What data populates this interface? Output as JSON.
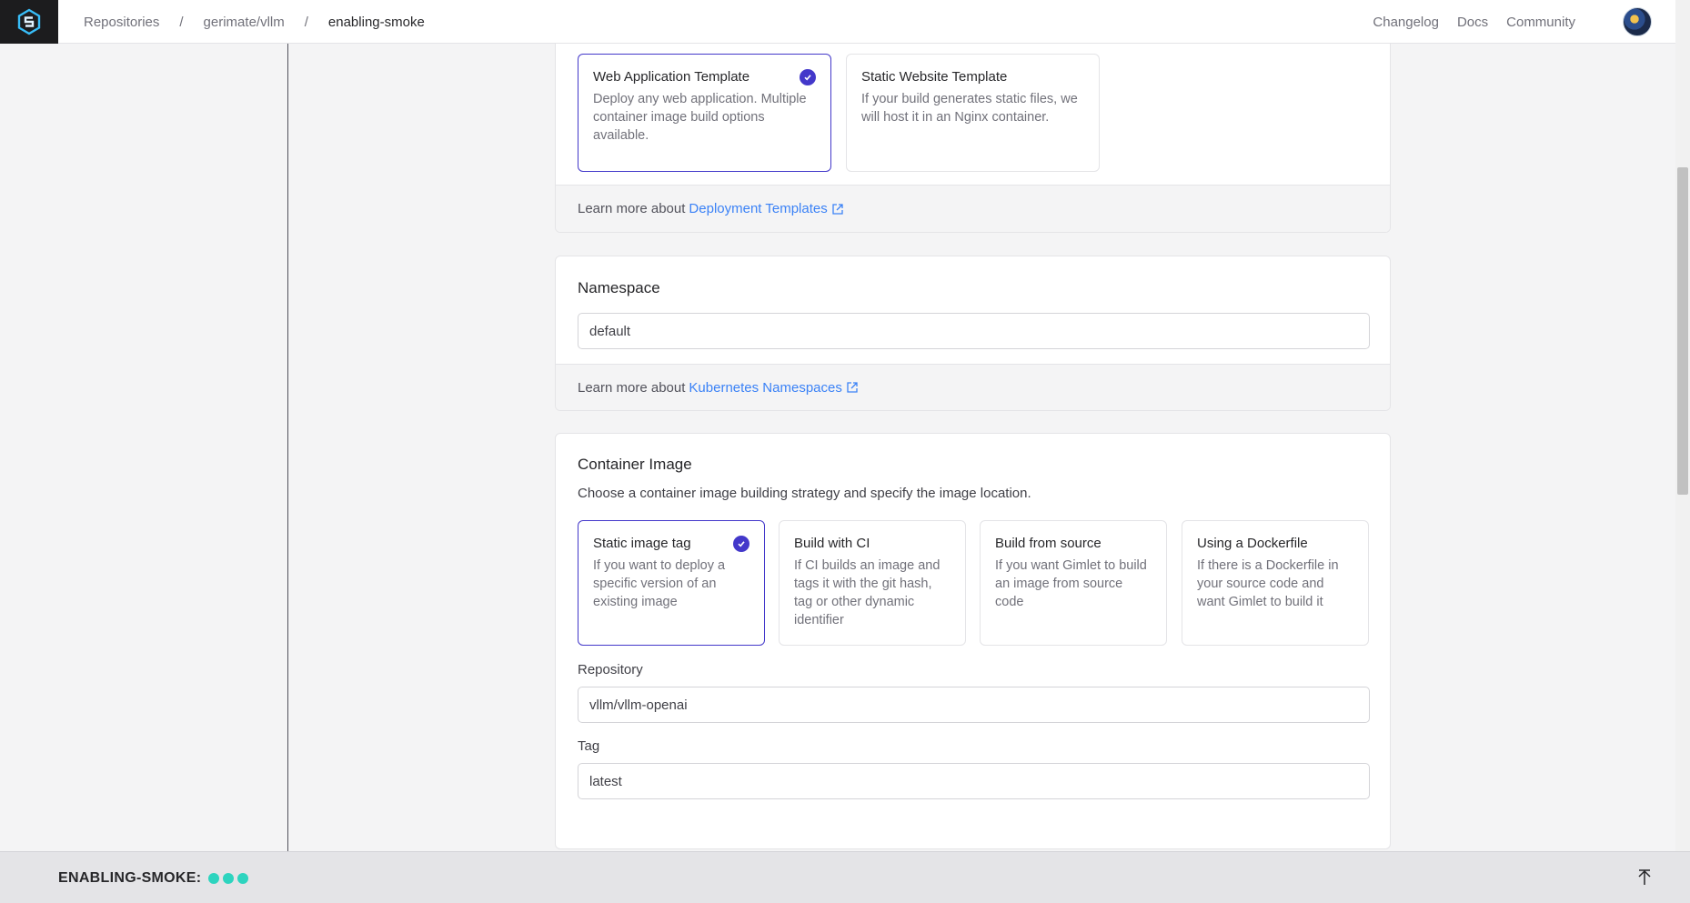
{
  "header": {
    "logo": "gimlet-logo-icon",
    "breadcrumbs": [
      "Repositories",
      "gerimate/vllm",
      "enabling-smoke"
    ],
    "separator": "/",
    "nav": [
      "Changelog",
      "Docs",
      "Community"
    ]
  },
  "templates": {
    "cards": [
      {
        "title": "Web Application Template",
        "desc": "Deploy any web application. Multiple container image build options available.",
        "selected": true
      },
      {
        "title": "Static Website Template",
        "desc": "If your build generates static files, we will host it in an Nginx container.",
        "selected": false
      }
    ],
    "footer_text": "Learn more about",
    "footer_link": "Deployment Templates"
  },
  "namespace": {
    "title": "Namespace",
    "value": "default",
    "footer_text": "Learn more about",
    "footer_link": "Kubernetes Namespaces"
  },
  "container_image": {
    "title": "Container Image",
    "subtitle": "Choose a container image building strategy and specify the image location.",
    "strategies": [
      {
        "title": "Static image tag",
        "desc": "If you want to deploy a specific version of an existing image",
        "selected": true
      },
      {
        "title": "Build with CI",
        "desc": "If CI builds an image and tags it with the git hash, tag or other dynamic identifier",
        "selected": false
      },
      {
        "title": "Build from source",
        "desc": "If you want Gimlet to build an image from source code",
        "selected": false
      },
      {
        "title": "Using a Dockerfile",
        "desc": "If there is a Dockerfile in your source code and want Gimlet to build it",
        "selected": false
      }
    ],
    "repository_label": "Repository",
    "repository_value": "vllm/vllm-openai",
    "tag_label": "Tag",
    "tag_value": "latest"
  },
  "bottom_bar": {
    "env_name": "ENABLING-SMOKE:",
    "status_color": "#2dd4bf"
  },
  "colors": {
    "accent": "#4338ca",
    "link": "#3b82f6"
  }
}
